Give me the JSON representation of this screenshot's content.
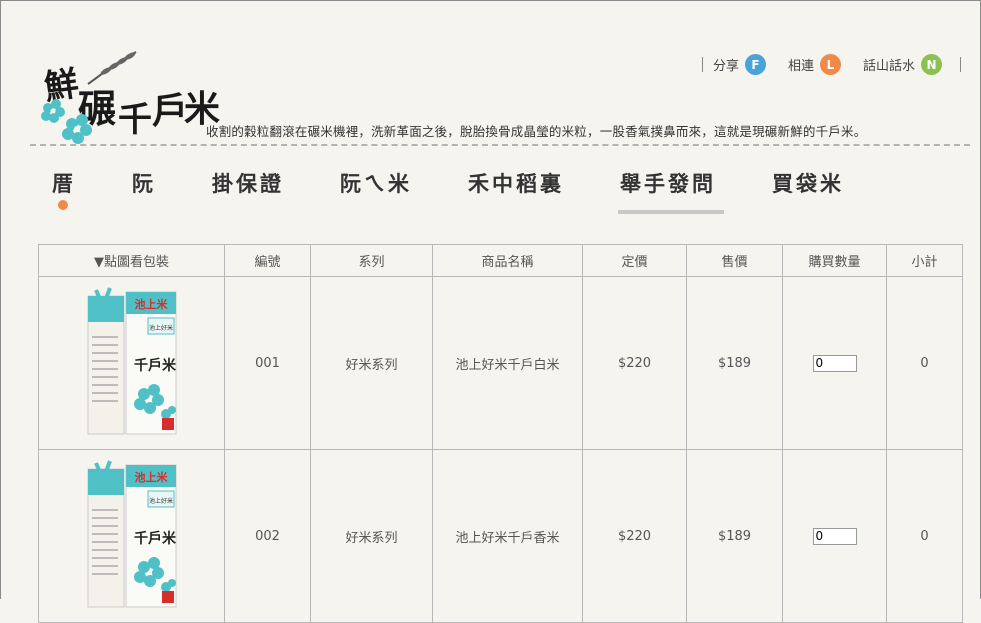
{
  "logo": {
    "chars": [
      "鮮",
      "碾",
      "千",
      "戶",
      "米"
    ]
  },
  "tagline": "收割的穀粒翻滾在碾米機裡，洗新革面之後，脫胎換骨成晶瑩的米粒，一股香氣撲鼻而來，這就是現碾新鮮的千戶米。",
  "toplinks": [
    {
      "label": "分享",
      "badge": "F",
      "color": "#4aa3d8"
    },
    {
      "label": "相連",
      "badge": "L",
      "color": "#f08a4b"
    },
    {
      "label": "話山話水",
      "badge": "N",
      "color": "#8cc152"
    }
  ],
  "nav": [
    "厝",
    "阮",
    "掛保證",
    "阮ㄟ米",
    "禾中稻裏",
    "舉手發問",
    "買袋米"
  ],
  "table": {
    "headers": [
      "▼點圖看包裝",
      "編號",
      "系列",
      "商品名稱",
      "定價",
      "售價",
      "購買數量",
      "小計"
    ],
    "rows": [
      {
        "id": "001",
        "series": "好米系列",
        "name": "池上好米千戶白米",
        "list_price": "$220",
        "price": "$189",
        "qty": "0",
        "subtotal": "0"
      },
      {
        "id": "002",
        "series": "好米系列",
        "name": "池上好米千戶香米",
        "list_price": "$220",
        "price": "$189",
        "qty": "0",
        "subtotal": "0"
      }
    ]
  },
  "package": {
    "top_label": "池上米",
    "side_label": "池上好米",
    "main": "千戶米"
  }
}
